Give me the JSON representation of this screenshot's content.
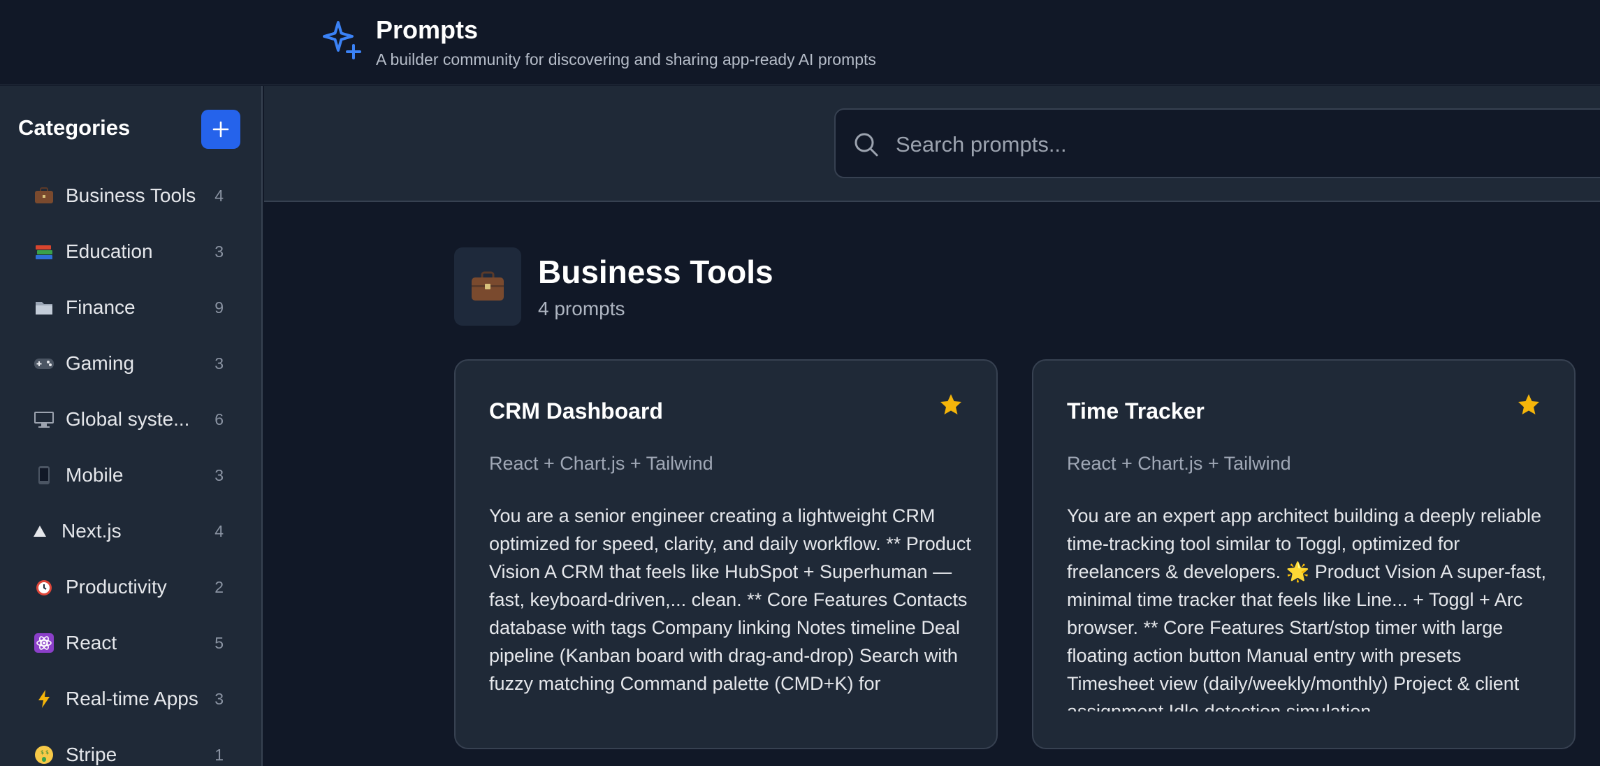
{
  "header": {
    "title": "Prompts",
    "subtitle": "A builder community for discovering and sharing app-ready AI prompts",
    "logo_icon": "sparkles-icon",
    "accent": "#2563eb"
  },
  "sidebar": {
    "heading": "Categories",
    "add_icon": "plus-icon",
    "items": [
      {
        "emoji": "💼",
        "label": "Business Tools",
        "count": "4"
      },
      {
        "emoji": "📚",
        "label": "Education",
        "count": "3"
      },
      {
        "emoji": "📁",
        "label": "Finance",
        "count": "9"
      },
      {
        "emoji": "🎮",
        "label": "Gaming",
        "count": "3"
      },
      {
        "emoji": "🖥️",
        "label": "Global syste...",
        "count": "6"
      },
      {
        "emoji": "📱",
        "label": "Mobile",
        "count": "3"
      },
      {
        "emoji": "▲",
        "label": "Next.js",
        "count": "4"
      },
      {
        "emoji": "⏰",
        "label": "Productivity",
        "count": "2"
      },
      {
        "emoji": "⚛️",
        "label": "React",
        "count": "5"
      },
      {
        "emoji": "⚡",
        "label": "Real-time Apps",
        "count": "3"
      },
      {
        "emoji": "🤑",
        "label": "Stripe",
        "count": "1"
      }
    ]
  },
  "search": {
    "placeholder": "Search prompts...",
    "icon": "search-icon"
  },
  "category_header": {
    "emoji": "💼",
    "title": "Business Tools",
    "count_label": "4 prompts"
  },
  "cards": [
    {
      "title": "CRM Dashboard",
      "stack": "React + Chart.js + Tailwind",
      "body": "You are a senior engineer creating a lightweight CRM optimized for speed, clarity, and daily workflow. ** Product Vision A CRM that feels like HubSpot + Superhuman — fast, keyboard-driven,... clean. ** Core Features Contacts database with tags Company linking Notes timeline Deal pipeline (Kanban board with drag-and-drop) Search with fuzzy matching Command palette (CMD+K) for",
      "starred": true
    },
    {
      "title": "Time Tracker",
      "stack": "React + Chart.js + Tailwind",
      "body": "You are an expert app architect building a deeply reliable time-tracking tool similar to Toggl, optimized for freelancers & developers. 🌟 Product Vision A super-fast, minimal time tracker that feels like Line... + Toggl + Arc browser. ** Core Features Start/stop timer with large floating action button Manual entry with presets Timesheet view (daily/weekly/monthly) Project & client assignment Idle detection simulation",
      "starred": true
    }
  ],
  "colors": {
    "star": "#f5b50a",
    "background": "#111827",
    "panel": "#1f2937"
  }
}
